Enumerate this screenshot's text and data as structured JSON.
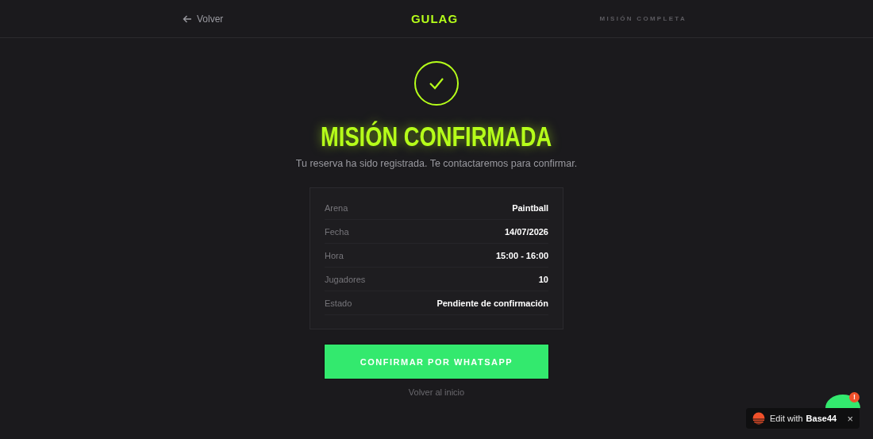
{
  "header": {
    "back_link": "Volver",
    "logo": "GULAG",
    "step": "MISIÓN COMPLETA"
  },
  "title": "MISIÓN CONFIRMADA",
  "subtitle": "Tu reserva ha sido registrada. Te contactaremos para confirmar.",
  "details": [
    {
      "label": "Arena",
      "value": "Paintball"
    },
    {
      "label": "Fecha",
      "value": "14/07/2026"
    },
    {
      "label": "Hora",
      "value": "15:00 - 16:00"
    },
    {
      "label": "Jugadores",
      "value": "10"
    },
    {
      "label": "Estado",
      "value": "Pendiente de confirmación"
    }
  ],
  "primary_button": "CONFIRMAR POR WHATSAPP",
  "home_link": "Volver al inicio",
  "chat_bubble": {
    "badge": "!"
  },
  "edit_badge": {
    "prefix": "Edit with",
    "brand": "Base44",
    "close": "×"
  }
}
